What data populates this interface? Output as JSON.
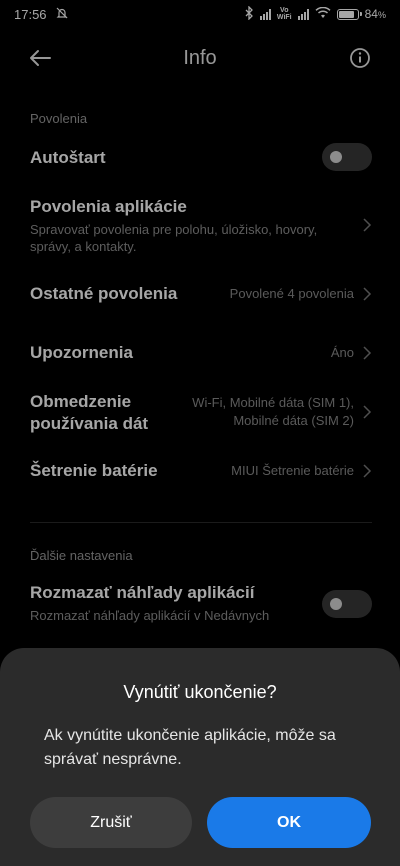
{
  "status_bar": {
    "time": "17:56",
    "volte_top": "Vo",
    "volte_bottom": "WiFi",
    "battery": "84",
    "battery_pct_sign": "%",
    "battery_level": 0.84
  },
  "header": {
    "title": "Info"
  },
  "sections": {
    "permissions_label": "Povolenia",
    "more_label": "Ďalšie nastavenia"
  },
  "rows": {
    "autostart": {
      "title": "Autoštart",
      "enabled": false
    },
    "app_permissions": {
      "title": "Povolenia aplikácie",
      "subtitle": "Spravovať povolenia pre polohu, úložisko, hovory, správy, a kontakty."
    },
    "other_permissions": {
      "title": "Ostatné povolenia",
      "value": "Povolené 4 povolenia"
    },
    "notifications": {
      "title": "Upozornenia",
      "value": "Áno"
    },
    "data_usage": {
      "title": "Obmedzenie používania dát",
      "value": "Wi-Fi, Mobilné dáta (SIM 1), Mobilné dáta (SIM 2)"
    },
    "battery_saver": {
      "title": "Šetrenie batérie",
      "value": "MIUI Šetrenie batérie"
    },
    "blur_previews": {
      "title": "Rozmazať náhľady aplikácií",
      "subtitle": "Rozmazať náhľady aplikácií v Nedávnych",
      "enabled": false
    }
  },
  "dialog": {
    "title": "Vynútiť ukončenie?",
    "message": "Ak vynútite ukončenie aplikácie, môže sa správať nesprávne.",
    "cancel_label": "Zrušiť",
    "ok_label": "OK"
  },
  "colors": {
    "background": "#000000",
    "dialog_bg": "#2b2b2b",
    "accent": "#1a7ae8"
  },
  "icons": [
    "mute-bell-icon",
    "bluetooth-icon",
    "signal-icon",
    "wifi-icon",
    "battery-icon",
    "back-arrow-icon",
    "info-icon",
    "chevron-right-icon"
  ]
}
